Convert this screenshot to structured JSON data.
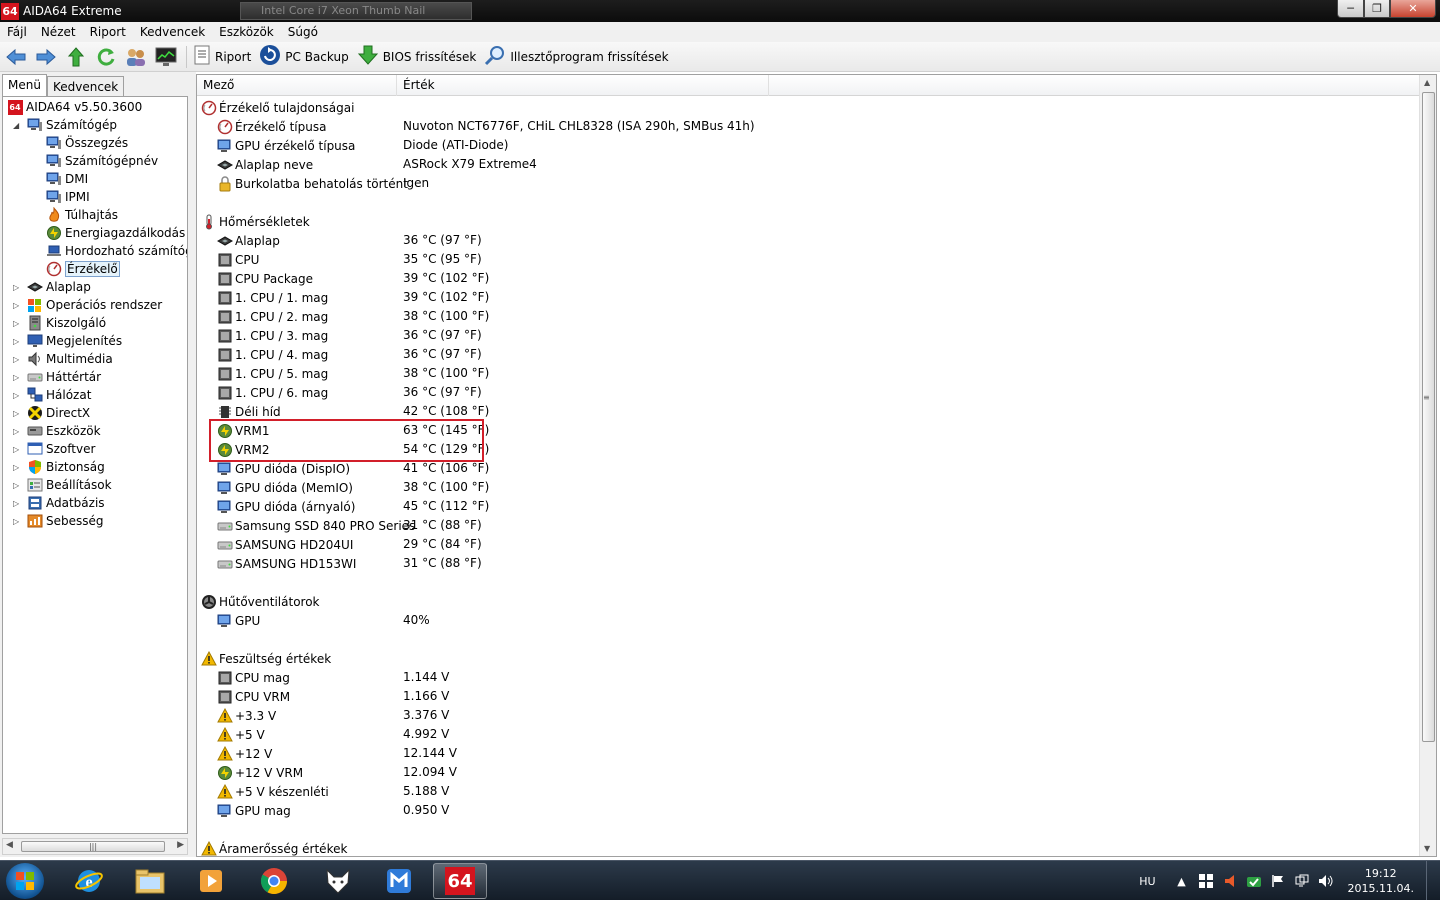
{
  "window": {
    "badge": "64",
    "title": "AIDA64 Extreme",
    "ghost_tab": "Intel Core i7 Xeon Thumb Nail"
  },
  "menubar": [
    "Fájl",
    "Nézet",
    "Riport",
    "Kedvencek",
    "Eszközök",
    "Súgó"
  ],
  "toolbar": {
    "report": "Riport",
    "backup": "PC Backup",
    "bios": "BIOS frissítések",
    "driver": "Illesztőprogram frissítések"
  },
  "left_tabs": [
    "Menü",
    "Kedvencek"
  ],
  "tree": [
    {
      "label": "AIDA64 v5.50.3600",
      "icon": "aida64-icon"
    },
    {
      "label": "Számítógép",
      "icon": "computer-icon"
    },
    {
      "label": "Összegzés",
      "icon": "computer-icon"
    },
    {
      "label": "Számítógépnév",
      "icon": "computer-icon"
    },
    {
      "label": "DMI",
      "icon": "computer-icon"
    },
    {
      "label": "IPMI",
      "icon": "computer-icon"
    },
    {
      "label": "Túlhajtás",
      "icon": "flame-icon"
    },
    {
      "label": "Energiagazdálkodás",
      "icon": "power-icon"
    },
    {
      "label": "Hordozható számítógé",
      "icon": "laptop-icon"
    },
    {
      "label": "Érzékelő",
      "icon": "sensor-icon"
    },
    {
      "label": "Alaplap",
      "icon": "motherboard-icon"
    },
    {
      "label": "Operációs rendszer",
      "icon": "windows-icon"
    },
    {
      "label": "Kiszolgáló",
      "icon": "server-icon"
    },
    {
      "label": "Megjelenítés",
      "icon": "display-icon"
    },
    {
      "label": "Multimédia",
      "icon": "speaker-icon"
    },
    {
      "label": "Háttértár",
      "icon": "disk-icon"
    },
    {
      "label": "Hálózat",
      "icon": "network-icon"
    },
    {
      "label": "DirectX",
      "icon": "directx-icon"
    },
    {
      "label": "Eszközök",
      "icon": "devices-icon"
    },
    {
      "label": "Szoftver",
      "icon": "software-icon"
    },
    {
      "label": "Biztonság",
      "icon": "shield-icon"
    },
    {
      "label": "Beállítások",
      "icon": "settings-icon"
    },
    {
      "label": "Adatbázis",
      "icon": "database-icon"
    },
    {
      "label": "Sebesség",
      "icon": "speed-icon"
    }
  ],
  "columns": {
    "field": "Mező",
    "value": "Érték"
  },
  "rows": [
    {
      "type": "section",
      "field": "Érzékelő tulajdonságai",
      "value": "",
      "icon": "sensor-icon"
    },
    {
      "type": "item",
      "field": "Érzékelő típusa",
      "value": "Nuvoton NCT6776F, CHiL CHL8328  (ISA 290h, SMBus 41h)",
      "icon": "sensor-icon"
    },
    {
      "type": "item",
      "field": "GPU érzékelő típusa",
      "value": "Diode  (ATI-Diode)",
      "icon": "gpu-icon"
    },
    {
      "type": "item",
      "field": "Alaplap neve",
      "value": "ASRock X79 Extreme4",
      "icon": "motherboard-icon"
    },
    {
      "type": "item",
      "field": "Burkolatba behatolás történt",
      "value": "Igen",
      "icon": "lock-icon"
    },
    {
      "type": "blank"
    },
    {
      "type": "section",
      "field": "Hőmérsékletek",
      "value": "",
      "icon": "thermometer-icon"
    },
    {
      "type": "item",
      "field": "Alaplap",
      "value": "36 °C  (97 °F)",
      "icon": "motherboard-icon"
    },
    {
      "type": "item",
      "field": "CPU",
      "value": "35 °C  (95 °F)",
      "icon": "cpu-icon"
    },
    {
      "type": "item",
      "field": "CPU Package",
      "value": "39 °C  (102 °F)",
      "icon": "cpu-icon"
    },
    {
      "type": "item",
      "field": "1. CPU / 1. mag",
      "value": "39 °C  (102 °F)",
      "icon": "cpu-icon"
    },
    {
      "type": "item",
      "field": "1. CPU / 2. mag",
      "value": "38 °C  (100 °F)",
      "icon": "cpu-icon"
    },
    {
      "type": "item",
      "field": "1. CPU / 3. mag",
      "value": "36 °C  (97 °F)",
      "icon": "cpu-icon"
    },
    {
      "type": "item",
      "field": "1. CPU / 4. mag",
      "value": "36 °C  (97 °F)",
      "icon": "cpu-icon"
    },
    {
      "type": "item",
      "field": "1. CPU / 5. mag",
      "value": "38 °C  (100 °F)",
      "icon": "cpu-icon"
    },
    {
      "type": "item",
      "field": "1. CPU / 6. mag",
      "value": "36 °C  (97 °F)",
      "icon": "cpu-icon"
    },
    {
      "type": "item",
      "field": "Déli híd",
      "value": "42 °C  (108 °F)",
      "icon": "chip-icon"
    },
    {
      "type": "item",
      "field": "VRM1",
      "value": "63 °C  (145 °F)",
      "icon": "power-icon"
    },
    {
      "type": "item",
      "field": "VRM2",
      "value": "54 °C  (129 °F)",
      "icon": "power-icon"
    },
    {
      "type": "item",
      "field": "GPU dióda (DispIO)",
      "value": "41 °C  (106 °F)",
      "icon": "gpu-icon"
    },
    {
      "type": "item",
      "field": "GPU dióda (MemIO)",
      "value": "38 °C  (100 °F)",
      "icon": "gpu-icon"
    },
    {
      "type": "item",
      "field": "GPU dióda (árnyaló)",
      "value": "45 °C  (112 °F)",
      "icon": "gpu-icon"
    },
    {
      "type": "item",
      "field": "Samsung SSD 840 PRO Series",
      "value": "31 °C  (88 °F)",
      "icon": "disk-icon"
    },
    {
      "type": "item",
      "field": "SAMSUNG HD204UI",
      "value": "29 °C  (84 °F)",
      "icon": "disk-icon"
    },
    {
      "type": "item",
      "field": "SAMSUNG HD153WI",
      "value": "31 °C  (88 °F)",
      "icon": "disk-icon"
    },
    {
      "type": "blank"
    },
    {
      "type": "section",
      "field": "Hűtőventilátorok",
      "value": "",
      "icon": "fan-icon"
    },
    {
      "type": "item",
      "field": "GPU",
      "value": "40%",
      "icon": "gpu-icon"
    },
    {
      "type": "blank"
    },
    {
      "type": "section",
      "field": "Feszültség értékek",
      "value": "",
      "icon": "warning-icon"
    },
    {
      "type": "item",
      "field": "CPU mag",
      "value": "1.144 V",
      "icon": "cpu-icon"
    },
    {
      "type": "item",
      "field": "CPU VRM",
      "value": "1.166 V",
      "icon": "cpu-icon"
    },
    {
      "type": "item",
      "field": "+3.3 V",
      "value": "3.376 V",
      "icon": "warning-icon"
    },
    {
      "type": "item",
      "field": "+5 V",
      "value": "4.992 V",
      "icon": "warning-icon"
    },
    {
      "type": "item",
      "field": "+12 V",
      "value": "12.144 V",
      "icon": "warning-icon"
    },
    {
      "type": "item",
      "field": "+12 V VRM",
      "value": "12.094 V",
      "icon": "power-icon"
    },
    {
      "type": "item",
      "field": "+5 V készenléti",
      "value": "5.188 V",
      "icon": "warning-icon"
    },
    {
      "type": "item",
      "field": "GPU mag",
      "value": "0.950 V",
      "icon": "gpu-icon"
    },
    {
      "type": "blank"
    },
    {
      "type": "section",
      "field": "Áramerősség értékek",
      "value": "",
      "icon": "warning-icon"
    }
  ],
  "taskbar": {
    "apps": [
      "internet-explorer-icon",
      "file-explorer-icon",
      "media-player-icon",
      "chrome-icon",
      "fox-app-icon",
      "maxthon-icon",
      "aida64-icon"
    ],
    "active_app_label": "64",
    "lang": "HU",
    "time": "19:12",
    "date": "2015.11.04."
  },
  "colors": {
    "highlight_box": "#d21f2a",
    "selection": "#e5f3fb",
    "titlebar": "#111111"
  }
}
